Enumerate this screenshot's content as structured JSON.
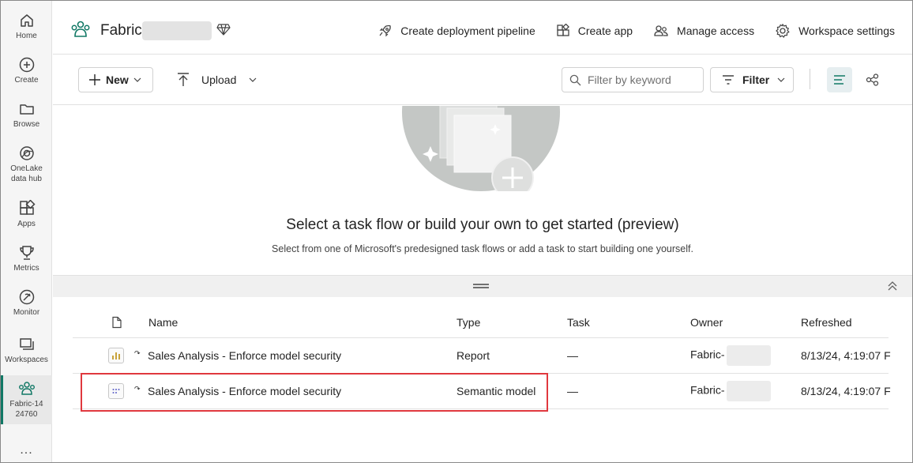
{
  "rail": {
    "items": [
      {
        "label": "Home",
        "icon": "home-icon"
      },
      {
        "label": "Create",
        "icon": "create-icon"
      },
      {
        "label": "Browse",
        "icon": "browse-icon"
      },
      {
        "label": "OneLake data hub",
        "icon": "onelake-icon"
      },
      {
        "label": "Apps",
        "icon": "apps-icon"
      },
      {
        "label": "Metrics",
        "icon": "trophy-icon"
      },
      {
        "label": "Monitor",
        "icon": "monitor-icon"
      },
      {
        "label": "Workspaces",
        "icon": "workspaces-icon"
      },
      {
        "label": "Fabric-1424760",
        "icon": "workspace-people-icon"
      }
    ],
    "more": "..."
  },
  "header": {
    "workspace_title": "Fabric-",
    "actions": [
      {
        "label": "Create deployment pipeline",
        "icon": "rocket-icon"
      },
      {
        "label": "Create app",
        "icon": "app-icon"
      },
      {
        "label": "Manage access",
        "icon": "people-icon"
      },
      {
        "label": "Workspace settings",
        "icon": "gear-icon"
      }
    ]
  },
  "toolbar": {
    "new_label": "New",
    "upload_label": "Upload",
    "search_placeholder": "Filter by keyword",
    "filter_label": "Filter"
  },
  "taskflow": {
    "title": "Select a task flow or build your own to get started (preview)",
    "subtitle": "Select from one of Microsoft's predesigned task flows or add a task to start building one yourself."
  },
  "table": {
    "columns": {
      "name": "Name",
      "type": "Type",
      "task": "Task",
      "owner": "Owner",
      "refreshed": "Refreshed"
    },
    "rows": [
      {
        "name": "Sales Analysis - Enforce model security",
        "type": "Report",
        "task": "—",
        "owner": "Fabric-",
        "refreshed": "8/13/24, 4:19:07 F",
        "icon": "report-icon"
      },
      {
        "name": "Sales Analysis - Enforce model security",
        "type": "Semantic model",
        "task": "—",
        "owner": "Fabric-",
        "refreshed": "8/13/24, 4:19:07 F",
        "icon": "semantic-model-icon"
      }
    ]
  },
  "colors": {
    "accent": "#117865",
    "highlight": "#e0383e"
  }
}
